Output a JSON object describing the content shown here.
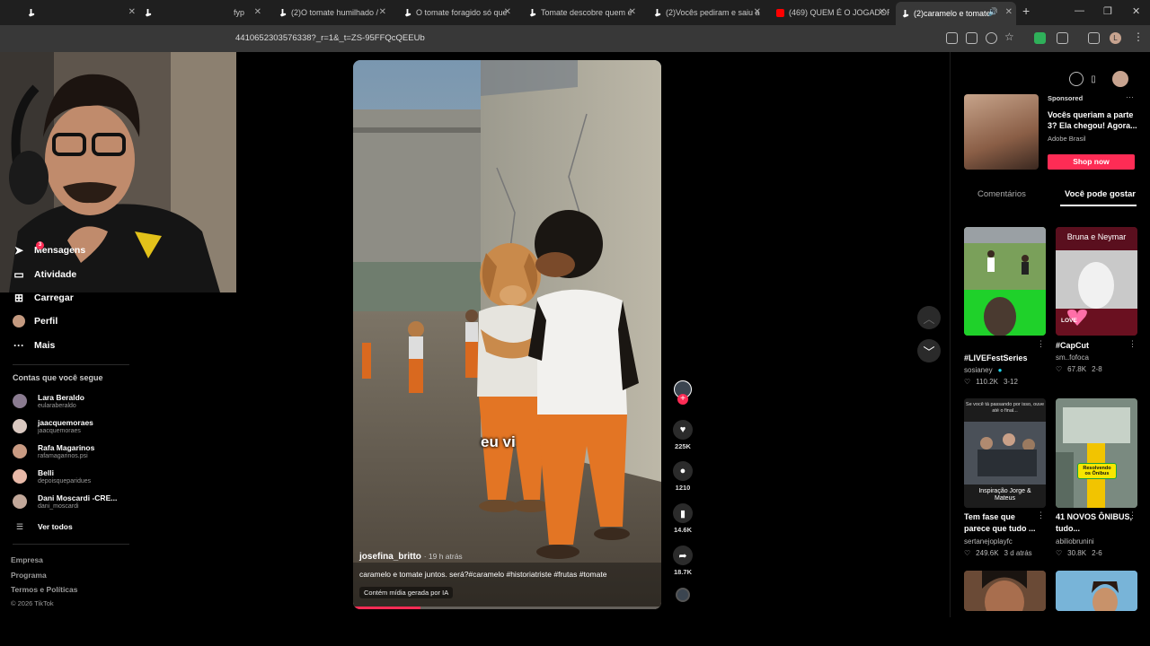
{
  "browser": {
    "tabs": [
      {
        "title": "",
        "type": "tiktok"
      },
      {
        "title": "fyp",
        "type": "tiktok"
      },
      {
        "title": "(2)O tomate humilhado /",
        "type": "tiktok"
      },
      {
        "title": "O tomate foragido só que",
        "type": "tiktok"
      },
      {
        "title": "Tomate descobre quem é",
        "type": "tiktok"
      },
      {
        "title": "(2)Vocês pediram e saiu a",
        "type": "tiktok"
      },
      {
        "title": "(469) QUEM É O JOGADOR",
        "type": "youtube"
      },
      {
        "title": "(2)caramelo e tomate",
        "type": "tiktok",
        "active": true
      }
    ],
    "new_tab": "+",
    "url": "4410652303576338?_r=1&_t=ZS-95FFQcQEEUb",
    "profile_letter": "L"
  },
  "sidebar": {
    "nav": [
      {
        "label": "Mensagens",
        "icon": "send-icon",
        "badge": "3"
      },
      {
        "label": "Atividade",
        "icon": "inbox-icon"
      },
      {
        "label": "Carregar",
        "icon": "plus-square-icon"
      },
      {
        "label": "Perfil",
        "icon": "avatar-icon"
      },
      {
        "label": "Mais",
        "icon": "more-icon"
      }
    ],
    "following_title": "Contas que você segue",
    "following": [
      {
        "name": "Lara Beraldo",
        "handle": "eularaberaldo",
        "color": "#8a7b90"
      },
      {
        "name": "jaacquemoraes",
        "handle": "jaacquemoraes",
        "color": "#d9c8c0"
      },
      {
        "name": "Rafa Magarinos",
        "handle": "rafamagarinos.psi",
        "color": "#c99a82"
      },
      {
        "name": "Belli",
        "handle": "depoisqueparidues",
        "color": "#e8b9a8"
      },
      {
        "name": "Dani Moscardi -CRE...",
        "handle": "dani_moscardi",
        "color": "#c2a89a"
      }
    ],
    "see_all": "Ver todos",
    "footer": [
      "Empresa",
      "Programa",
      "Termos e Políticas"
    ],
    "copyright": "© 2026 TikTok"
  },
  "video": {
    "caption_overlay": "eu vi",
    "author": "josefina_britto",
    "time_ago": "· 19 h atrás",
    "description": "caramelo e tomate juntos. será?#caramelo #historiatriste #frutas #tomate",
    "ai_label": "Contém mídia gerada por IA",
    "progress": 0.22,
    "likes": "225K",
    "comments": "1210",
    "saves": "14.6K",
    "shares": "18.7K"
  },
  "right_panel": {
    "ad": {
      "tag": "Sponsored",
      "title": "Vocês queriam a parte 3? Ela chegou! Agora...",
      "brand": "Adobe Brasil",
      "cta": "Shop now",
      "cta_color": "#fe2c55"
    },
    "tabs": [
      "Comentários",
      "Você pode gostar"
    ],
    "cards": [
      {
        "title": "#LIVEFestSeries",
        "author": "sosianey",
        "views": "110.2K",
        "date": "3-12",
        "emoji": "👏😍👏"
      },
      {
        "title": "#CapCut",
        "author": "sm..fofoca",
        "views": "67.8K",
        "date": "2-8",
        "overlay": "Bruna e Neymar",
        "love": "LOVE"
      },
      {
        "title": "Tem fase que parece que tudo ...",
        "author": "sertanejoplayfc",
        "views": "249.6K",
        "date": "3 d atrás",
        "overlay": "Se você tá passando por isso, ouve até o final...",
        "sub": "Inspiração Jorge & Mateus"
      },
      {
        "title": "41 NOVOS ÔNIBUS, tudo...",
        "author": "abiliobrunini",
        "views": "30.8K",
        "date": "2-6",
        "overlay": "Resolvendo os Ônibus"
      }
    ]
  }
}
